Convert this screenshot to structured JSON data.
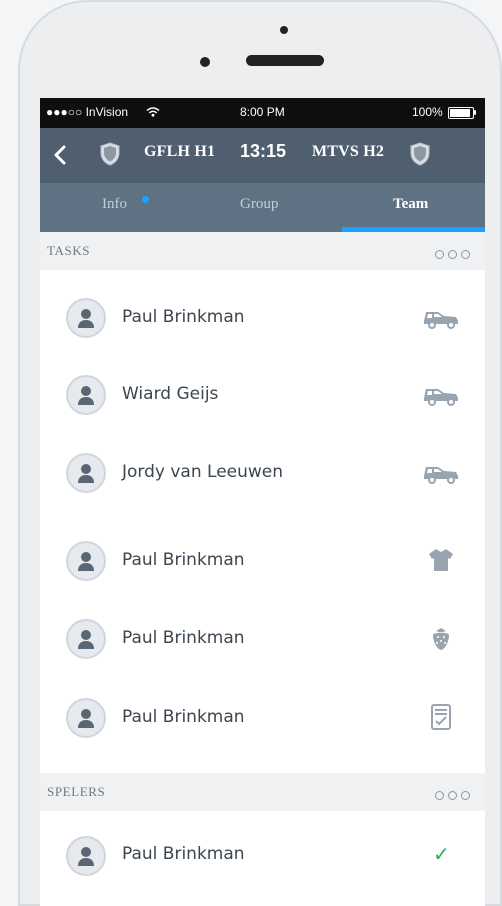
{
  "status_bar": {
    "carrier": "●●●○○ InVision",
    "time": "8:00 PM",
    "battery": "100%",
    "battery_level": 1.0
  },
  "match": {
    "home_team": "GFLH H1",
    "time": "13:15",
    "away_team": "MTVS H2"
  },
  "tabs": [
    {
      "label": "Info",
      "selected": false,
      "has_notification_dot": true
    },
    {
      "label": "Group",
      "selected": false
    },
    {
      "label": "Team",
      "selected": true
    }
  ],
  "sections": {
    "tasks": {
      "title": "TASKS",
      "items": [
        {
          "name": "Paul Brinkman",
          "icon": "car-icon"
        },
        {
          "name": "Wiard Geijs",
          "icon": "car-icon"
        },
        {
          "name": "Jordy van Leeuwen",
          "icon": "car-icon"
        },
        {
          "name": "Paul Brinkman",
          "icon": "shirt-icon"
        },
        {
          "name": "Paul Brinkman",
          "icon": "strawberry-icon"
        },
        {
          "name": "Paul Brinkman",
          "icon": "checklist-icon"
        }
      ]
    },
    "players": {
      "title": "SPELERS",
      "items": [
        {
          "name": "Paul Brinkman",
          "status": "✓"
        }
      ]
    }
  },
  "colors": {
    "navbar": "#4f5f70",
    "tabs": "#5f7283",
    "accent": "#1aa3ff",
    "check": "#1fb653"
  }
}
